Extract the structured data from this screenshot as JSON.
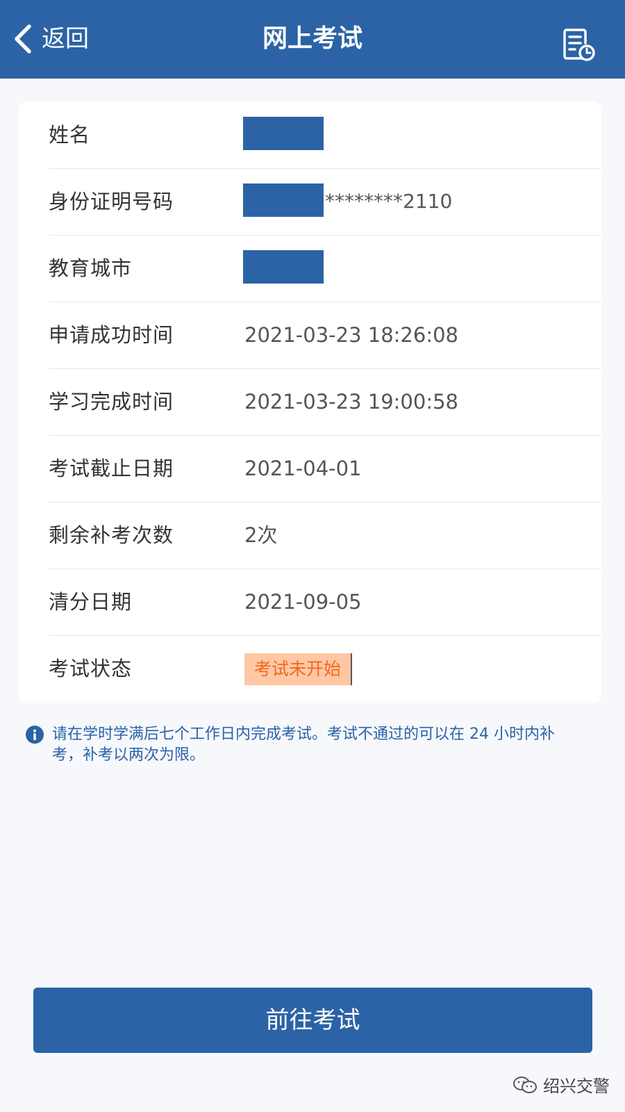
{
  "header": {
    "back_label": "返回",
    "title": "网上考试",
    "record_icon": "exam-record-icon"
  },
  "info_rows": [
    {
      "label": "姓名",
      "value": "",
      "redacted": true
    },
    {
      "label": "身份证明号码",
      "value": "********2110",
      "redacted": true
    },
    {
      "label": "教育城市",
      "value": "",
      "redacted": true
    },
    {
      "label": "申请成功时间",
      "value": "2021-03-23 18:26:08"
    },
    {
      "label": "学习完成时间",
      "value": "2021-03-23 19:00:58"
    },
    {
      "label": "考试截止日期",
      "value": "2021-04-01"
    },
    {
      "label": "剩余补考次数",
      "value": "2次"
    },
    {
      "label": "清分日期",
      "value": "2021-09-05"
    },
    {
      "label": "考试状态",
      "value": "考试未开始"
    }
  ],
  "notice": {
    "icon": "info-icon",
    "text": "请在学时学满后七个工作日内完成考试。考试不通过的可以在 24 小时内补考，补考以两次为限。"
  },
  "action": {
    "go_exam_label": "前往考试"
  },
  "watermark": {
    "text": "绍兴交警"
  },
  "colors": {
    "primary": "#2b63a6",
    "background": "#f6f8fc",
    "status_bg": "#ffc7a4",
    "status_text": "#ee6a1c"
  }
}
